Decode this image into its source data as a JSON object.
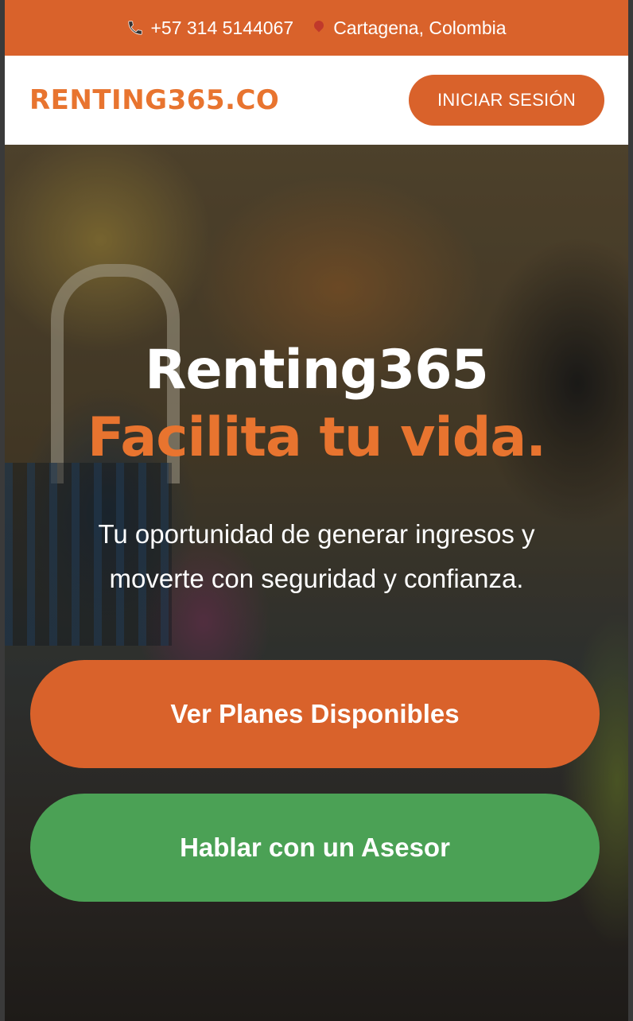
{
  "topbar": {
    "phone": "+57 314 5144067",
    "location": "Cartagena, Colombia",
    "phone_icon": "phone-icon",
    "location_icon": "map-pin-icon"
  },
  "header": {
    "logo": "RENTING365.CO",
    "login_label": "INICIAR SESIÓN"
  },
  "hero": {
    "title": "Renting365",
    "subtitle": "Facilita tu vida.",
    "description_line1": "Tu oportunidad de generar ingresos y",
    "description_line2": "moverte con seguridad y confianza.",
    "cta_primary": "Ver Planes Disponibles",
    "cta_secondary": "Hablar con un Asesor"
  },
  "colors": {
    "brand_orange": "#D9622B",
    "accent_orange": "#E8742F",
    "green": "#4BA155",
    "white": "#FFFFFF"
  }
}
